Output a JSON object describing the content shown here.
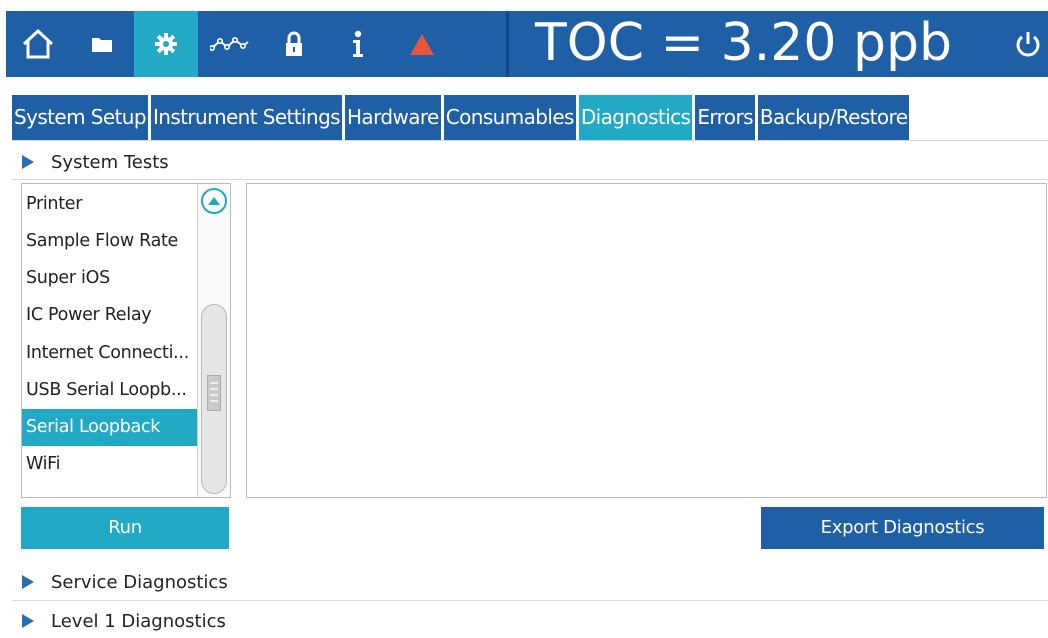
{
  "header": {
    "nav_icons": [
      {
        "name": "home-icon"
      },
      {
        "name": "folder-icon"
      },
      {
        "name": "gear-icon",
        "active": true
      },
      {
        "name": "trend-icon"
      },
      {
        "name": "lock-icon"
      },
      {
        "name": "info-icon"
      },
      {
        "name": "alarm-icon",
        "color": "#e8553b"
      }
    ],
    "toc_reading": "TOC = 3.20 ppb",
    "power_icon": "power-icon"
  },
  "tabs": [
    {
      "label": "System Setup"
    },
    {
      "label": "Instrument Settings"
    },
    {
      "label": "Hardware"
    },
    {
      "label": "Consumables"
    },
    {
      "label": "Diagnostics",
      "active": true
    },
    {
      "label": "Errors"
    },
    {
      "label": "Backup/Restore"
    }
  ],
  "sections": {
    "system_tests": "System Tests",
    "service_diagnostics": "Service Diagnostics",
    "level1_diagnostics": "Level 1 Diagnostics"
  },
  "tests_list": {
    "items": [
      "Printer",
      "Sample Flow Rate",
      "Super iOS",
      "IC Power Relay",
      "Internet Connecti...",
      "USB Serial Loopb...",
      "Serial Loopback",
      "WiFi"
    ],
    "selected": "Serial Loopback"
  },
  "buttons": {
    "run": "Run",
    "export": "Export Diagnostics"
  },
  "colors": {
    "brand_blue": "#1f5fa6",
    "accent_cyan": "#22a9c6",
    "alarm": "#e8553b"
  }
}
